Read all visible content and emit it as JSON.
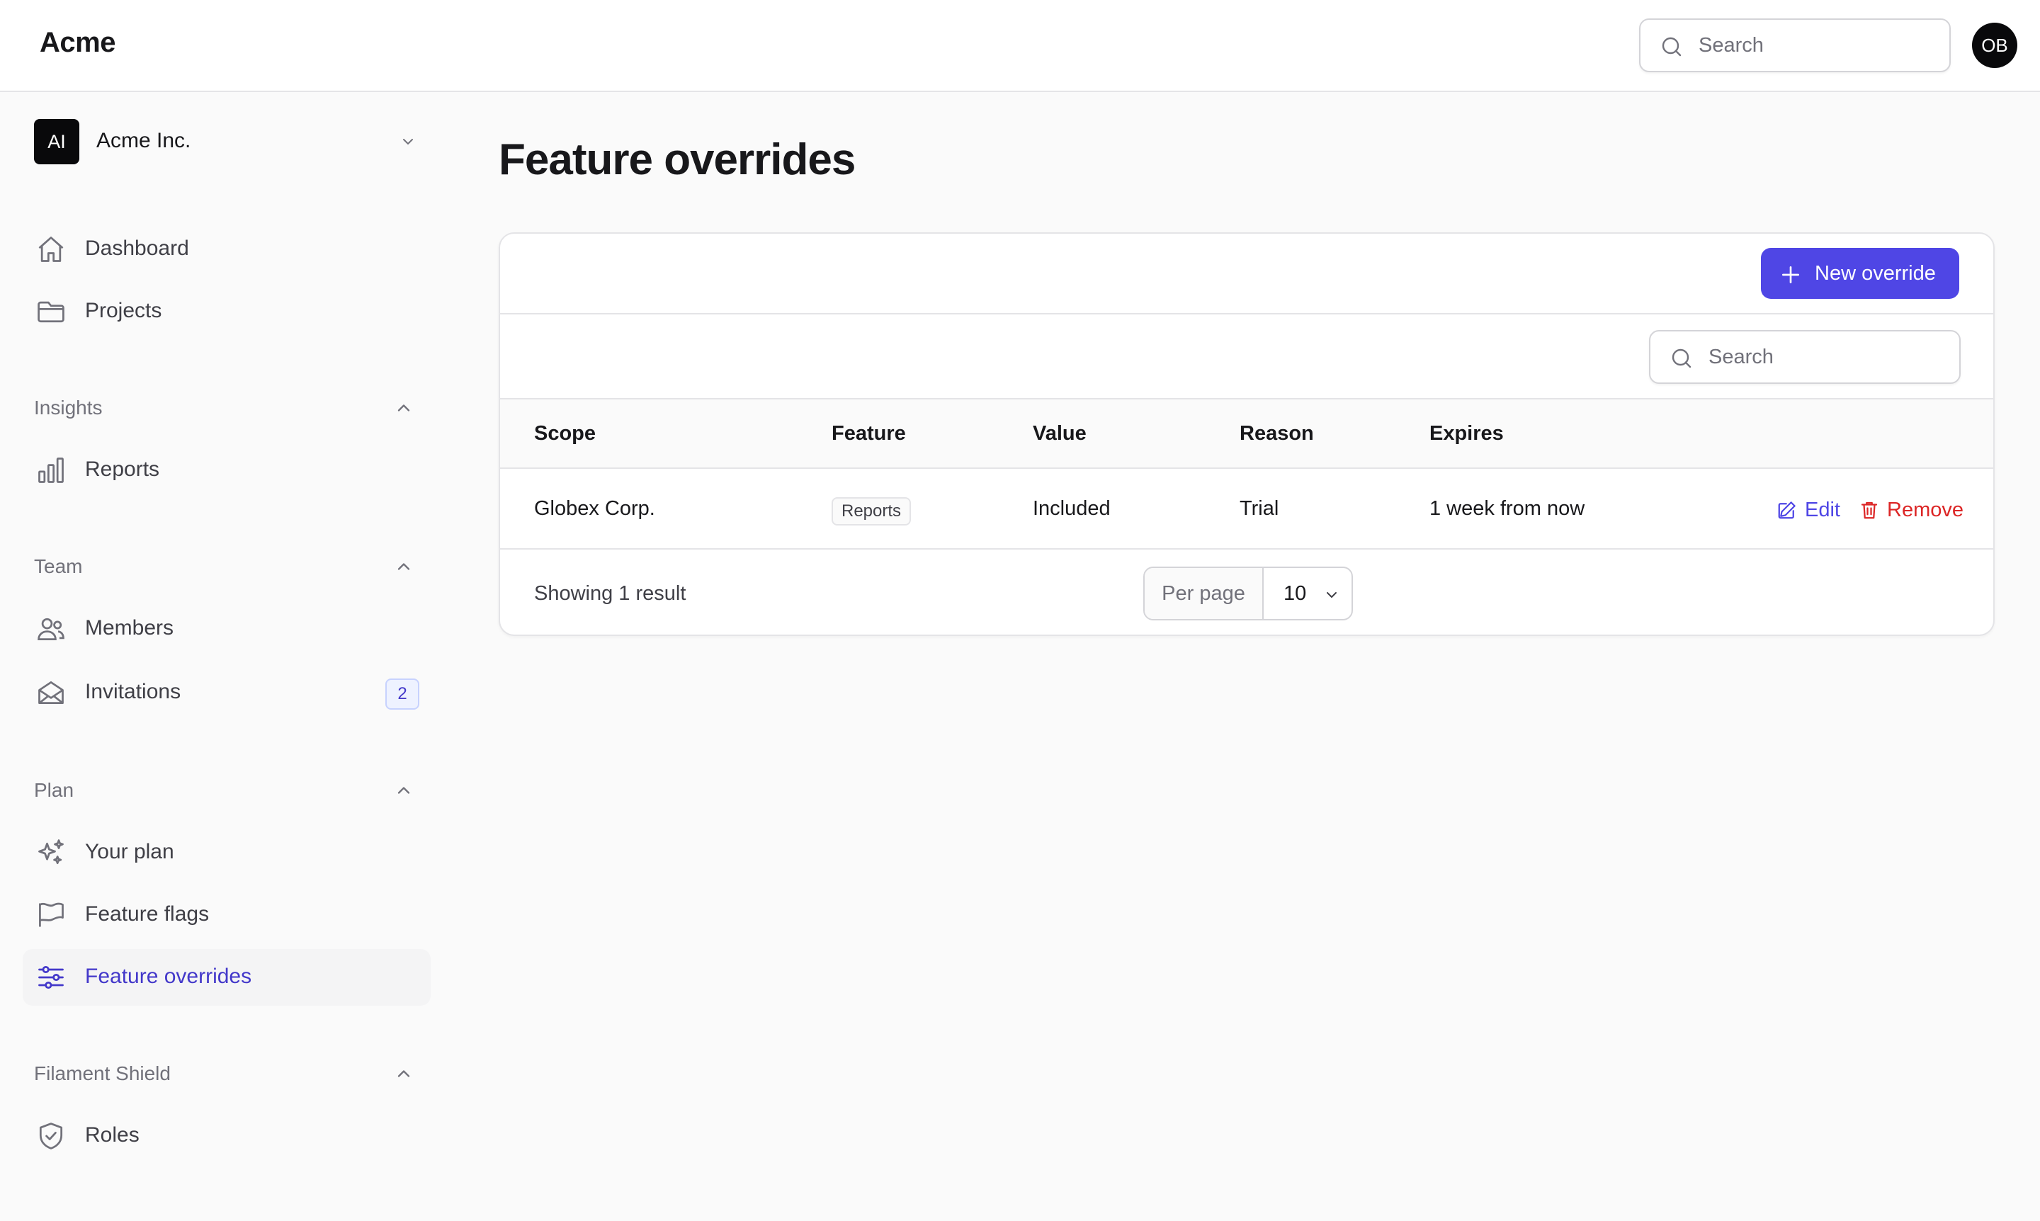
{
  "app": {
    "brand": "Acme"
  },
  "header": {
    "search_placeholder": "Search",
    "avatar_initials": "OB"
  },
  "sidebar": {
    "tenant": {
      "initials": "AI",
      "name": "Acme Inc."
    },
    "top_items": [
      {
        "label": "Dashboard",
        "icon": "home-icon"
      },
      {
        "label": "Projects",
        "icon": "folder-icon"
      }
    ],
    "groups": [
      {
        "label": "Insights",
        "items": [
          {
            "label": "Reports",
            "icon": "chart-bar-icon"
          }
        ]
      },
      {
        "label": "Team",
        "items": [
          {
            "label": "Members",
            "icon": "users-icon"
          },
          {
            "label": "Invitations",
            "icon": "envelope-open-icon",
            "badge": "2"
          }
        ]
      },
      {
        "label": "Plan",
        "items": [
          {
            "label": "Your plan",
            "icon": "sparkles-icon"
          },
          {
            "label": "Feature flags",
            "icon": "flag-icon"
          },
          {
            "label": "Feature overrides",
            "icon": "adjustments-icon",
            "active": true
          }
        ]
      },
      {
        "label": "Filament Shield",
        "items": [
          {
            "label": "Roles",
            "icon": "shield-check-icon"
          }
        ]
      }
    ]
  },
  "main": {
    "title": "Feature overrides",
    "new_button_label": "New override",
    "table_search_placeholder": "Search",
    "columns": [
      "Scope",
      "Feature",
      "Value",
      "Reason",
      "Expires"
    ],
    "rows": [
      {
        "scope": "Globex Corp.",
        "feature": "Reports",
        "value": "Included",
        "reason": "Trial",
        "expires": "1 week from now",
        "actions": {
          "edit": "Edit",
          "remove": "Remove"
        }
      }
    ],
    "footer": {
      "result_count": "Showing 1 result",
      "per_page_label": "Per page",
      "per_page_value": "10"
    }
  },
  "colors": {
    "primary": "#4f46e5",
    "danger": "#dc2626",
    "active_nav_text": "#4338ca",
    "background": "#fafafa"
  }
}
